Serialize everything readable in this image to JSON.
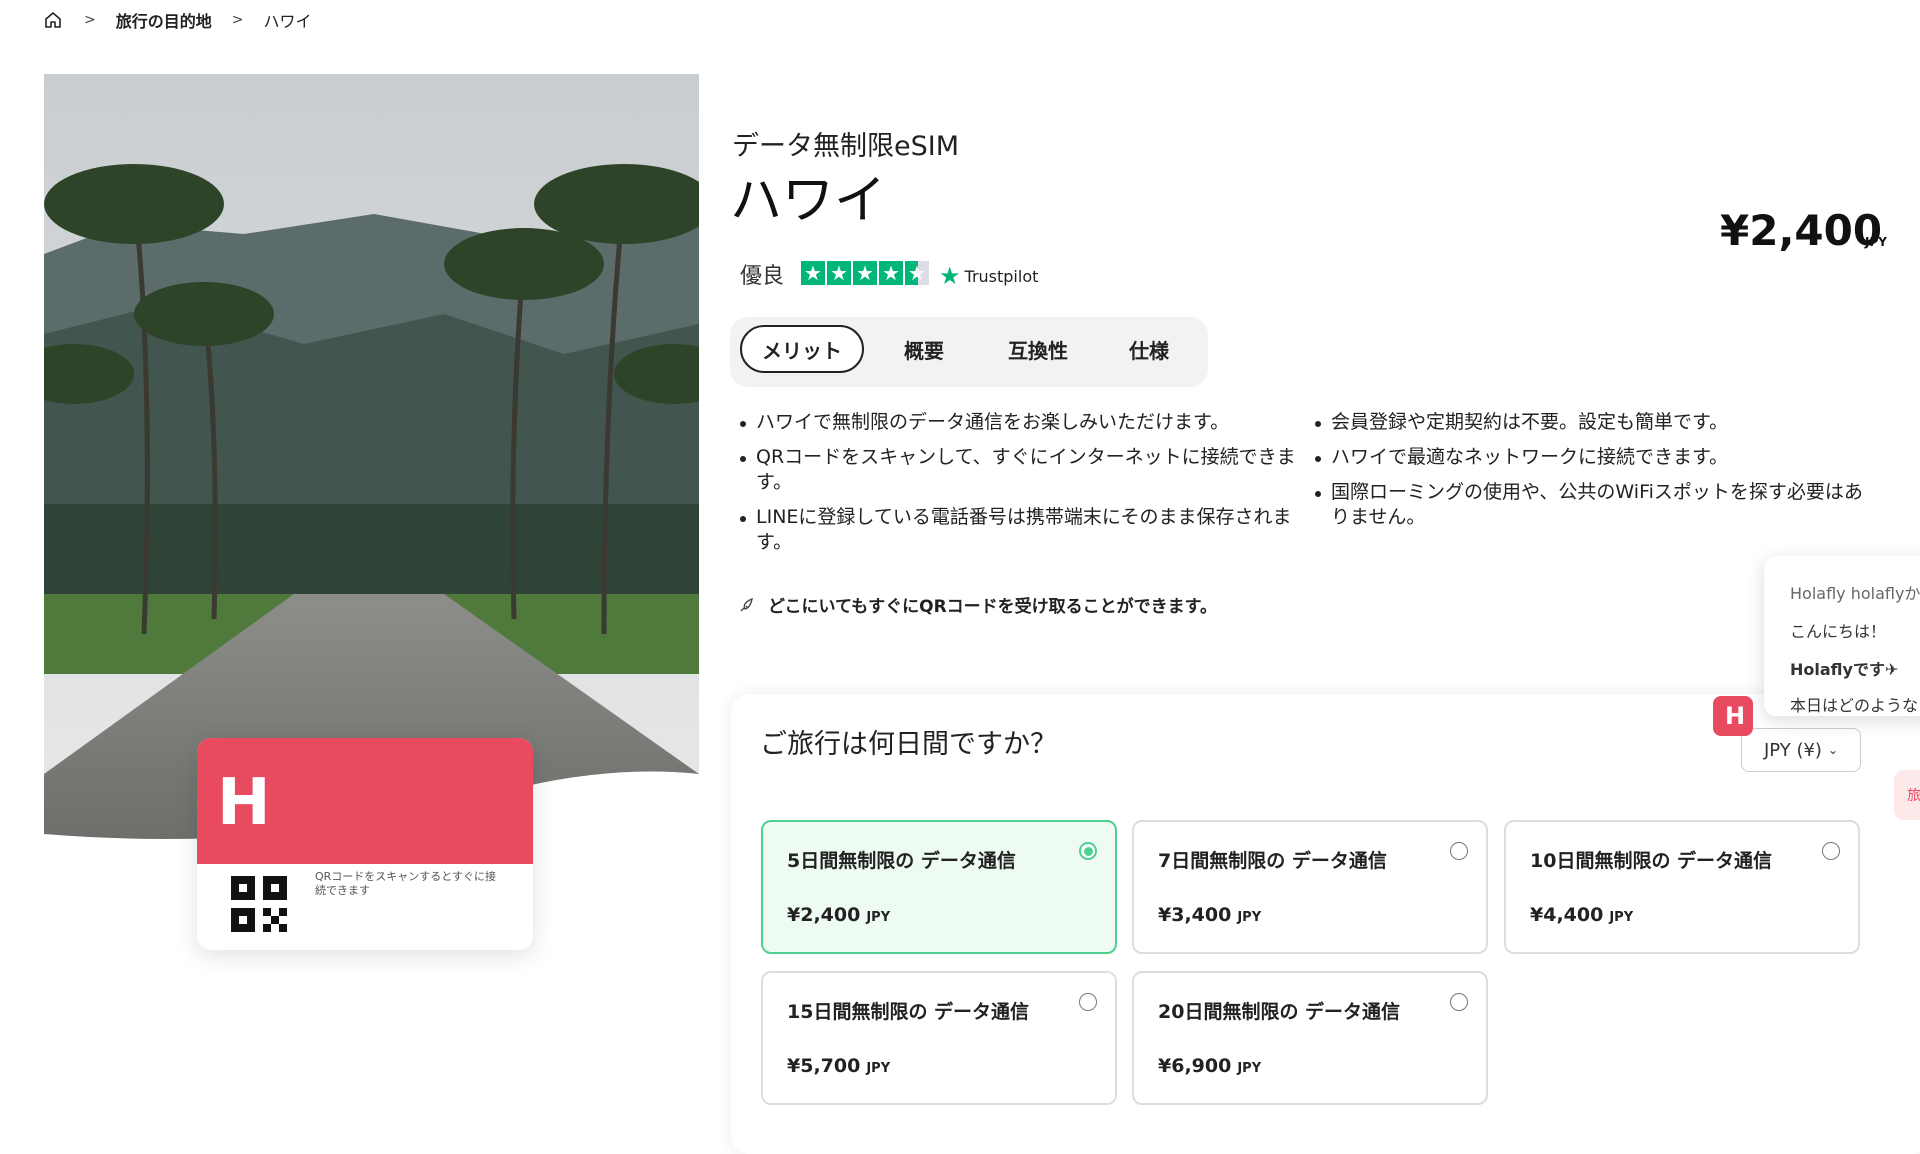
{
  "breadcrumb": {
    "home": "home",
    "items": [
      "旅行の目的地",
      "ハワイ"
    ]
  },
  "product": {
    "subtitle": "データ無制限eSIM",
    "title": "ハワイ",
    "price": "¥2,400",
    "currency": "JPY",
    "rating_label": "優良",
    "rating_stars": 4.5,
    "trustpilot": "Trustpilot"
  },
  "tabs": [
    "メリット",
    "概要",
    "互換性",
    "仕様"
  ],
  "benefits": {
    "left": [
      "ハワイで無制限のデータ通信をお楽しみいただけます。",
      "QRコードをスキャンして、すぐにインターネットに接続できます。",
      "LINEに登録している電話番号は携帯端末にそのまま保存されます。"
    ],
    "right": [
      "会員登録や定期契約は不要。設定も簡単です。",
      "ハワイで最適なネットワークに接続できます。",
      "国際ローミングの使用や、公共のWiFiスポットを探す必要はありません。"
    ],
    "qr_note": "どこにいてもすぐにQRコードを受け取ることができます。"
  },
  "card": {
    "logo": "H",
    "qr_text": "QRコードをスキャンするとすぐに接続できます"
  },
  "trip": {
    "question": "ご旅行は何日間ですか？",
    "currency_select": "JPY (¥)",
    "plans": [
      {
        "name": "5日間無制限の データ通信",
        "price": "¥2,400",
        "cur": "JPY",
        "selected": true
      },
      {
        "name": "7日間無制限の データ通信",
        "price": "¥3,400",
        "cur": "JPY",
        "selected": false
      },
      {
        "name": "10日間無制限の データ通信",
        "price": "¥4,400",
        "cur": "JPY",
        "selected": false
      },
      {
        "name": "15日間無制限の データ通信",
        "price": "¥5,700",
        "cur": "JPY",
        "selected": false
      },
      {
        "name": "20日間無制限の データ通信",
        "price": "¥6,900",
        "cur": "JPY",
        "selected": false
      }
    ]
  },
  "chat": {
    "line1": "Holafly holaflyか",
    "line2": "こんにちは！",
    "line3": "Holaflyです✈",
    "line4": "本日はどのようなこ",
    "avatar": "H",
    "side_tab": "旅"
  },
  "colors": {
    "brand": "#e84a5f",
    "selected": "#4ed08e",
    "trustpilot": "#00b67a"
  }
}
